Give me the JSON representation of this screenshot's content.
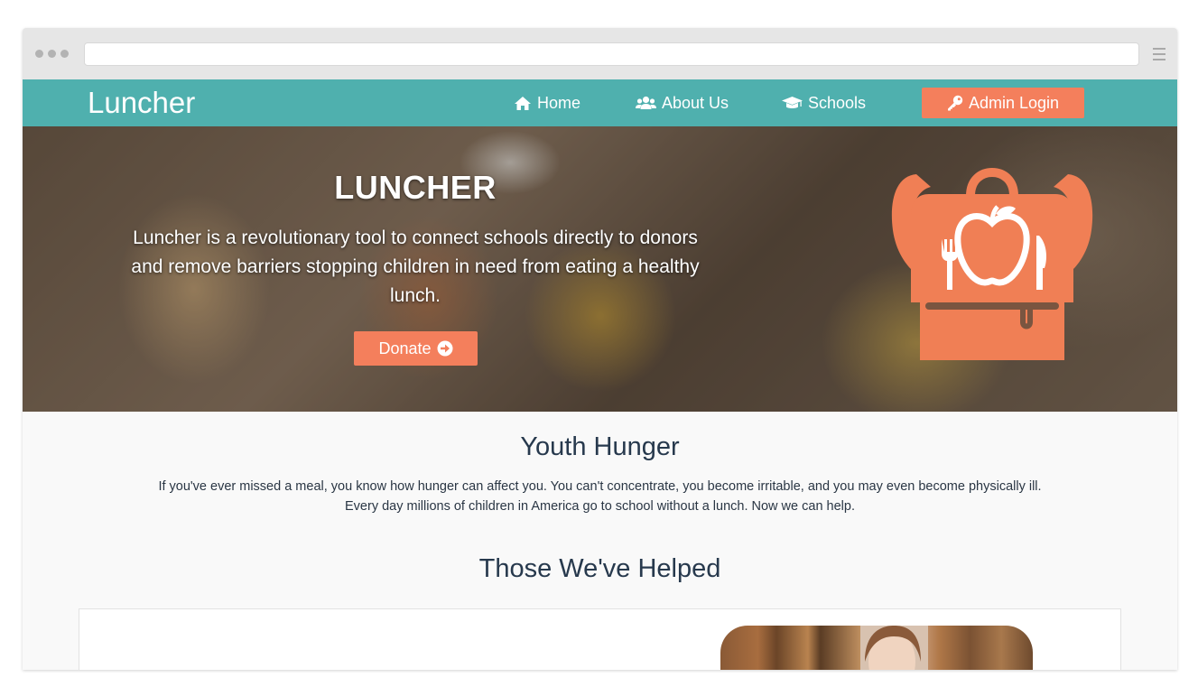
{
  "navbar": {
    "brand": "Luncher",
    "links": [
      {
        "label": "Home",
        "icon": "home-icon"
      },
      {
        "label": "About Us",
        "icon": "users-icon"
      },
      {
        "label": "Schools",
        "icon": "graduation-cap-icon"
      }
    ],
    "admin_login": {
      "label": "Admin Login",
      "icon": "key-icon"
    }
  },
  "hero": {
    "title": "LUNCHER",
    "description": "Luncher is a revolutionary tool to connect schools directly to donors and remove barriers stopping children in need from eating a healthy lunch.",
    "donate_button": {
      "label": "Donate",
      "icon": "arrow-circle-right-icon"
    },
    "illustration": "backpack-apple-utensils-icon"
  },
  "youth_hunger": {
    "title": "Youth Hunger",
    "line1": "If you've ever missed a meal, you know how hunger can affect you. You can't concentrate, you become irritable, and you may even become physically ill.",
    "line2": "Every day millions of children in America go to school without a lunch. Now we can help."
  },
  "helped": {
    "title": "Those We've Helped"
  },
  "colors": {
    "navbar": "#4fb0ae",
    "accent": "#f47f5c",
    "heading": "#27394d",
    "page_bg": "#f9f9f9"
  }
}
